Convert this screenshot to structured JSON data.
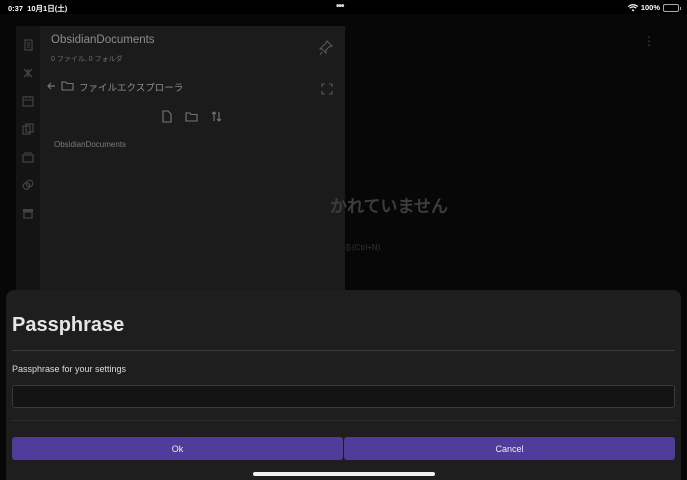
{
  "status_bar": {
    "time": "0:37",
    "date": "10月1日(土)",
    "center_dots": "•••",
    "battery_percent": "100%",
    "battery_level": 1.0,
    "battery_color": "#36c45a",
    "icons": [
      "wifi-icon",
      "battery-icon",
      "charging-bolt-icon"
    ]
  },
  "sidebar": {
    "vault_name": "ObsidianDocuments",
    "vault_stats": "0 ファイル, 0 フォルダ",
    "explorer_title": "ファイルエクスプローラ",
    "root_folder": "ObsidianDocuments",
    "ribbon_icons": [
      "files-icon",
      "graph-icon",
      "calendar-icon",
      "copy-icon",
      "cards-icon",
      "plugin-icon",
      "archive-icon"
    ],
    "toolbar_icons": [
      "new-note-icon",
      "new-folder-icon",
      "sort-icon"
    ]
  },
  "main": {
    "heading": "かれていません",
    "link": "る(Ctrl+N)",
    "more": "⋮"
  },
  "modal": {
    "title": "Passphrase",
    "label": "Passphrase for your settings",
    "input_value": "",
    "ok_label": "Ok",
    "cancel_label": "Cancel",
    "accent_color": "#4e3d9a"
  }
}
